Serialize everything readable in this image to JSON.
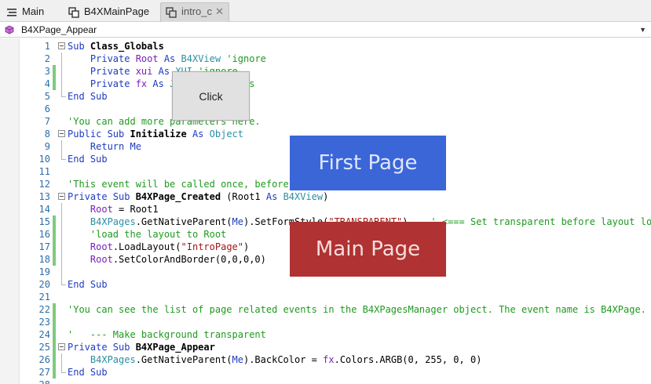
{
  "tabs": [
    {
      "label": "Main",
      "icon": "list-icon"
    },
    {
      "label": "B4XMainPage",
      "icon": "module-icon"
    },
    {
      "label": "intro_c",
      "icon": "module-icon",
      "active": true
    }
  ],
  "tab_close_glyph": "✕",
  "dropdown": {
    "value": "B4XPage_Appear",
    "icon": "cube-icon"
  },
  "buttons": {
    "click_label": "Click"
  },
  "overlays": {
    "first_page_label": "First Page",
    "main_page_label": "Main Page"
  },
  "colors": {
    "first_page": "#3b66d8",
    "main_page": "#b03232",
    "change_marker": "#7ecb7e"
  },
  "code_lines": [
    {
      "n": "1",
      "fold": "start",
      "tokens": [
        [
          "kw",
          "Sub "
        ],
        [
          "kwb",
          "Class_Globals"
        ]
      ]
    },
    {
      "n": "2",
      "fold": "mid",
      "tokens": [
        [
          "nm",
          "    "
        ],
        [
          "kw",
          "Private "
        ],
        [
          "vr",
          "Root"
        ],
        [
          "kw",
          " As "
        ],
        [
          "ty",
          "B4XView"
        ],
        [
          "cm",
          " 'ignore"
        ]
      ]
    },
    {
      "n": "3",
      "fold": "mid",
      "changed": true,
      "tokens": [
        [
          "nm",
          "    "
        ],
        [
          "kw",
          "Private "
        ],
        [
          "vr",
          "xui"
        ],
        [
          "kw",
          " As "
        ],
        [
          "ty",
          "XUI"
        ],
        [
          "cm",
          " 'ignore"
        ]
      ]
    },
    {
      "n": "4",
      "fold": "mid",
      "changed": true,
      "tokens": [
        [
          "nm",
          "    "
        ],
        [
          "kw",
          "Private "
        ],
        [
          "vr",
          "fx"
        ],
        [
          "kw",
          " As "
        ],
        [
          "ty",
          "JFX"
        ],
        [
          "cm",
          " 'added this"
        ]
      ]
    },
    {
      "n": "5",
      "fold": "end",
      "tokens": [
        [
          "kw",
          "End Sub"
        ]
      ]
    },
    {
      "n": "6",
      "fold": "none",
      "tokens": []
    },
    {
      "n": "7",
      "fold": "none",
      "tokens": [
        [
          "cm",
          "'You can add more parameters here."
        ]
      ]
    },
    {
      "n": "8",
      "fold": "start",
      "tokens": [
        [
          "kw",
          "Public Sub "
        ],
        [
          "kwb",
          "Initialize"
        ],
        [
          "kw",
          " As "
        ],
        [
          "ty",
          "Object"
        ]
      ]
    },
    {
      "n": "9",
      "fold": "mid",
      "tokens": [
        [
          "nm",
          "    "
        ],
        [
          "kw",
          "Return "
        ],
        [
          "kw",
          "Me"
        ]
      ]
    },
    {
      "n": "10",
      "fold": "end",
      "tokens": [
        [
          "kw",
          "End Sub"
        ]
      ]
    },
    {
      "n": "11",
      "fold": "none",
      "tokens": []
    },
    {
      "n": "12",
      "fold": "none",
      "tokens": [
        [
          "cm",
          "'This event will be called once, before the page becomes visible."
        ]
      ]
    },
    {
      "n": "13",
      "fold": "start",
      "tokens": [
        [
          "kw",
          "Private Sub "
        ],
        [
          "kwb",
          "B4XPage_Created"
        ],
        [
          "nm",
          " (Root1"
        ],
        [
          "kw",
          " As "
        ],
        [
          "ty",
          "B4XView"
        ],
        [
          "nm",
          ")"
        ]
      ]
    },
    {
      "n": "14",
      "fold": "mid",
      "tokens": [
        [
          "nm",
          "    "
        ],
        [
          "vr",
          "Root"
        ],
        [
          "nm",
          " = Root1"
        ]
      ]
    },
    {
      "n": "15",
      "fold": "mid",
      "changed": true,
      "tokens": [
        [
          "nm",
          "    "
        ],
        [
          "ty",
          "B4XPages"
        ],
        [
          "nm",
          ".GetNativeParent("
        ],
        [
          "kw",
          "Me"
        ],
        [
          "nm",
          ").SetFormStyle("
        ],
        [
          "st",
          "\"TRANSPARENT\""
        ],
        [
          "nm",
          ")    "
        ],
        [
          "cm",
          "' <=== Set transparent before layout load"
        ]
      ]
    },
    {
      "n": "16",
      "fold": "mid",
      "changed": true,
      "tokens": [
        [
          "nm",
          "    "
        ],
        [
          "cm",
          "'load the layout to Root"
        ]
      ]
    },
    {
      "n": "17",
      "fold": "mid",
      "changed": true,
      "tokens": [
        [
          "nm",
          "    "
        ],
        [
          "vr",
          "Root"
        ],
        [
          "nm",
          ".LoadLayout("
        ],
        [
          "st",
          "\"IntroPage\""
        ],
        [
          "nm",
          ")"
        ]
      ]
    },
    {
      "n": "18",
      "fold": "mid",
      "changed": true,
      "tokens": [
        [
          "nm",
          "    "
        ],
        [
          "vr",
          "Root"
        ],
        [
          "nm",
          ".SetColorAndBorder(0,0,0,0)"
        ]
      ]
    },
    {
      "n": "19",
      "fold": "mid",
      "tokens": []
    },
    {
      "n": "20",
      "fold": "end",
      "tokens": [
        [
          "kw",
          "End Sub"
        ]
      ]
    },
    {
      "n": "21",
      "fold": "none",
      "tokens": []
    },
    {
      "n": "22",
      "fold": "none",
      "changed": true,
      "tokens": [
        [
          "cm",
          "'You can see the list of page related events in the B4XPagesManager object. The event name is B4XPage."
        ]
      ]
    },
    {
      "n": "23",
      "fold": "none",
      "changed": true,
      "tokens": []
    },
    {
      "n": "24",
      "fold": "none",
      "changed": true,
      "tokens": [
        [
          "cm",
          "'   --- Make background transparent"
        ]
      ]
    },
    {
      "n": "25",
      "fold": "start",
      "changed": true,
      "tokens": [
        [
          "kw",
          "Private Sub "
        ],
        [
          "kwb",
          "B4XPage_Appear"
        ]
      ]
    },
    {
      "n": "26",
      "fold": "mid",
      "changed": true,
      "tokens": [
        [
          "nm",
          "    "
        ],
        [
          "ty",
          "B4XPages"
        ],
        [
          "nm",
          ".GetNativeParent("
        ],
        [
          "kw",
          "Me"
        ],
        [
          "nm",
          ").BackColor = "
        ],
        [
          "vr",
          "fx"
        ],
        [
          "nm",
          ".Colors.ARGB(0, 255, 0, 0)"
        ]
      ]
    },
    {
      "n": "27",
      "fold": "end",
      "changed": true,
      "tokens": [
        [
          "kw",
          "End Sub"
        ]
      ]
    },
    {
      "n": "28",
      "fold": "none",
      "tokens": []
    }
  ]
}
